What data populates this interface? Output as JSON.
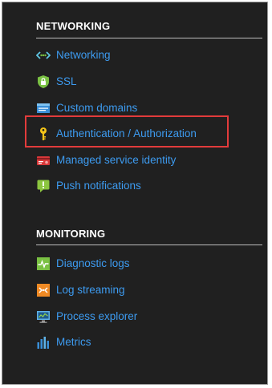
{
  "networking": {
    "header": "NETWORKING",
    "items": [
      {
        "label": "Networking",
        "icon": "networking-icon"
      },
      {
        "label": "SSL",
        "icon": "ssl-shield-icon"
      },
      {
        "label": "Custom domains",
        "icon": "custom-domains-icon"
      },
      {
        "label": "Authentication / Authorization",
        "icon": "key-icon"
      },
      {
        "label": "Managed service identity",
        "icon": "managed-identity-icon"
      },
      {
        "label": "Push notifications",
        "icon": "push-notifications-icon"
      }
    ]
  },
  "monitoring": {
    "header": "MONITORING",
    "items": [
      {
        "label": "Diagnostic logs",
        "icon": "diagnostic-logs-icon"
      },
      {
        "label": "Log streaming",
        "icon": "log-streaming-icon"
      },
      {
        "label": "Process explorer",
        "icon": "process-explorer-icon"
      },
      {
        "label": "Metrics",
        "icon": "metrics-icon"
      }
    ]
  },
  "colors": {
    "background": "#202020",
    "link": "#3d9bf0",
    "highlight": "#e23b3b"
  }
}
